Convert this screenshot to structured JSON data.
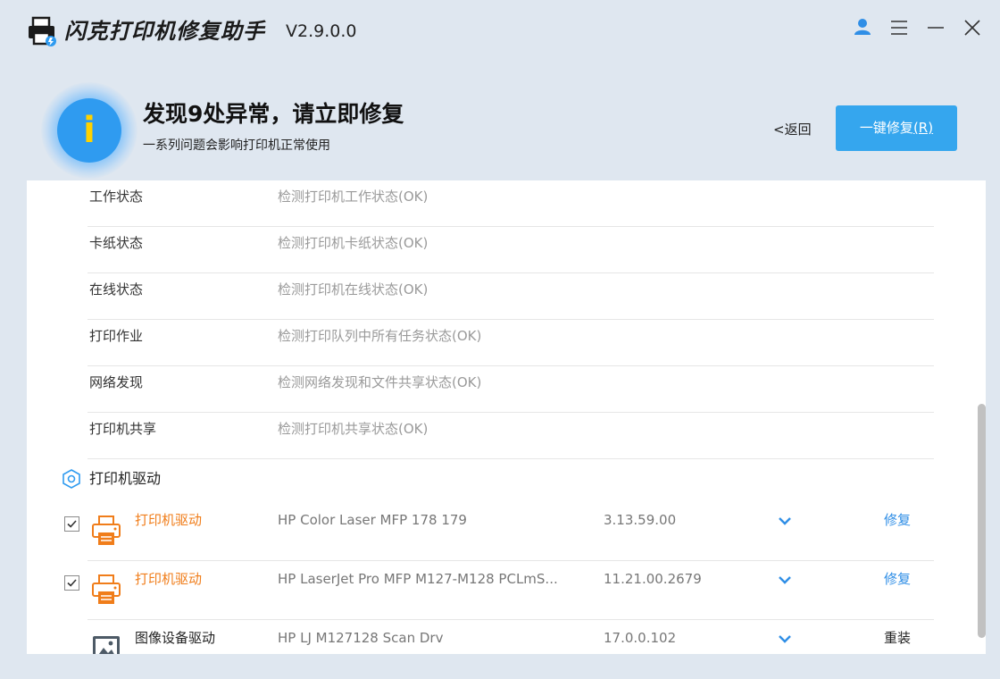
{
  "app": {
    "title": "闪克打印机修复助手",
    "version": "V2.9.0.0"
  },
  "header": {
    "alert_icon_glyph": "i",
    "headline": "发现9处异常，请立即修复",
    "subline": "一系列问题会影响打印机正常使用",
    "back_label": "<返回",
    "repair_all_label": "一键修复",
    "repair_all_hotkey": "(R)"
  },
  "status_items": [
    {
      "name": "工作状态",
      "desc": "检测打印机工作状态(OK)"
    },
    {
      "name": "卡纸状态",
      "desc": "检测打印机卡纸状态(OK)"
    },
    {
      "name": "在线状态",
      "desc": "检测打印机在线状态(OK)"
    },
    {
      "name": "打印作业",
      "desc": "检测打印队列中所有任务状态(OK)"
    },
    {
      "name": "网络发现",
      "desc": "检测网络发现和文件共享状态(OK)"
    },
    {
      "name": "打印机共享",
      "desc": "检测打印机共享状态(OK)"
    }
  ],
  "driver_section": {
    "title": "打印机驱动",
    "items": [
      {
        "type": "打印机驱动",
        "name": "HP Color Laser MFP 178 179",
        "version": "3.13.59.00",
        "action": "修复",
        "checked": true,
        "icon": "printer-icon"
      },
      {
        "type": "打印机驱动",
        "name": "HP LaserJet Pro MFP M127-M128 PCLmS...",
        "version": "11.21.00.2679",
        "action": "修复",
        "checked": true,
        "icon": "printer-icon"
      },
      {
        "type": "图像设备驱动",
        "name": "HP LJ M127128 Scan Drv",
        "version": "17.0.0.102",
        "action": "重装",
        "checked": false,
        "icon": "image-device-icon"
      }
    ]
  },
  "colors": {
    "accent_blue": "#35a6ee",
    "warning_orange": "#f07d1a",
    "link_blue": "#2f8ee6",
    "background": "#dfe7f0"
  }
}
